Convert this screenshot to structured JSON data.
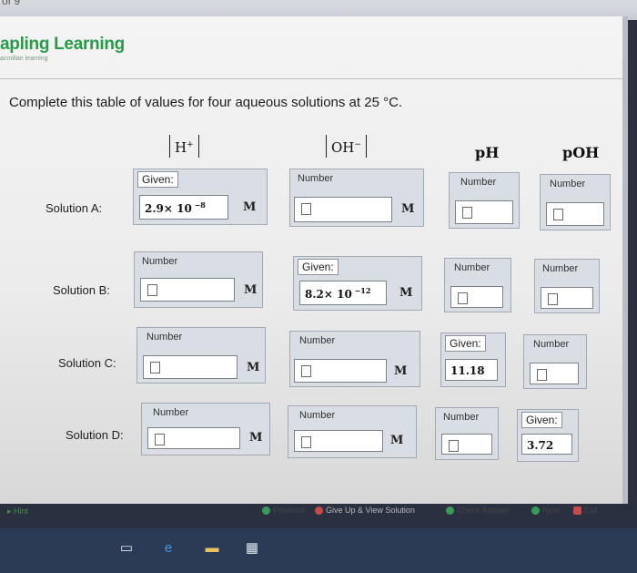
{
  "top_fragment": "of 9",
  "brand": {
    "title": "apling Learning",
    "subtitle": "acmillan learning"
  },
  "question": "Complete this table of values for four aqueous solutions at 25 °C.",
  "columns": {
    "h": {
      "base": "H",
      "sup": "+"
    },
    "oh": {
      "base": "OH",
      "sup": "−"
    },
    "ph": "pH",
    "poh": "pOH"
  },
  "rows": {
    "a": {
      "label": "Solution A:",
      "h_caption": "Given:",
      "h_mant": "2.9× 10",
      "h_exp": " −8",
      "h_unit": "M",
      "oh_caption": "Number",
      "oh_unit": "M",
      "ph_caption": "Number",
      "poh_caption": "Number"
    },
    "b": {
      "label": "Solution B:",
      "h_caption": "Number",
      "h_unit": "M",
      "oh_caption": "Given:",
      "oh_mant": "8.2× 10",
      "oh_exp": " −12",
      "oh_unit": "M",
      "ph_caption": "Number",
      "poh_caption": "Number"
    },
    "c": {
      "label": "Solution C:",
      "h_caption": "Number",
      "h_unit": "M",
      "oh_caption": "Number",
      "oh_unit": "M",
      "ph_caption": "Given:",
      "ph_value": "11.18",
      "poh_caption": "Number"
    },
    "d": {
      "label": "Solution D:",
      "h_caption": "Number",
      "h_unit": "M",
      "oh_caption": "Number",
      "oh_unit": "M",
      "ph_caption": "Number",
      "poh_caption": "Given:",
      "poh_value": "3.72"
    }
  },
  "footer": {
    "hint": "Hint",
    "previous": "Previous",
    "give_up": "Give Up & View Solution",
    "check": "Check Answer",
    "next": "Next",
    "exit": "Exit"
  },
  "colors": {
    "brand": "#2a9a4a",
    "taskbar": "#2b3a55",
    "cell": "#d9dde4"
  },
  "taskbar_icons": [
    "task-view-icon",
    "edge-browser-icon",
    "file-explorer-icon",
    "store-icon"
  ]
}
